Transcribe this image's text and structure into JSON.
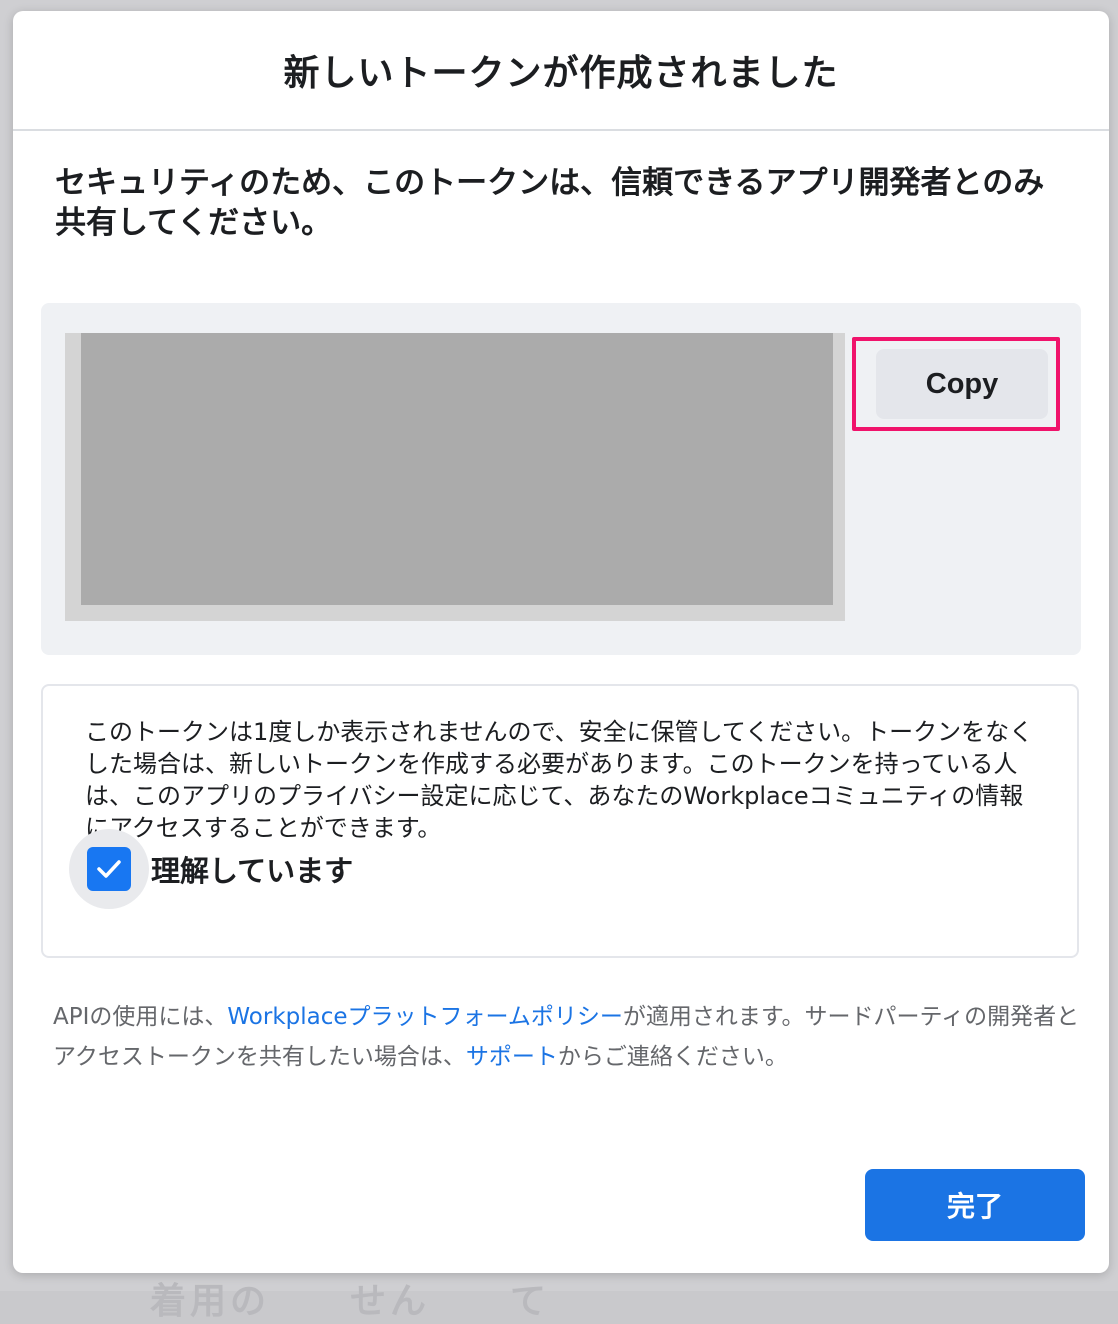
{
  "dialog": {
    "title": "新しいトークンが作成されました",
    "security_note": "セキュリティのため、このトークンは、信頼できるアプリ開発者とのみ共有してください。"
  },
  "token_panel": {
    "copy_label": "Copy"
  },
  "notice": {
    "text": "このトークンは1度しか表示されませんので、安全に保管してください。トークンをなくした場合は、新しいトークンを作成する必要があります。このトークンを持っている人は、このアプリのプライバシー設定に応じて、あなたのWorkplaceコミュニティの情報にアクセスすることができます。",
    "checkbox_label": "理解しています",
    "checkbox_checked": true
  },
  "policy": {
    "prefix": "APIの使用には、",
    "policy_link": "Workplaceプラットフォームポリシー",
    "middle": "が適用されます。サードパーティの開発者とアクセストークンを共有したい場合は、",
    "support_link": "サポート",
    "suffix": "からご連絡ください。"
  },
  "footer": {
    "done_label": "完了"
  },
  "backdrop": {
    "partial_text": "着用の　　せん　　て"
  },
  "colors": {
    "primary": "#1b74e4",
    "highlight": "#f0136b",
    "secondary_button": "#e4e6eb",
    "panel": "#eff1f4"
  }
}
